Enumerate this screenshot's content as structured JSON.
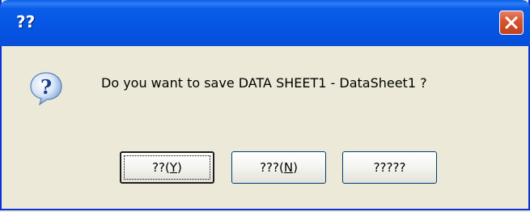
{
  "dialog": {
    "title": "??",
    "message": "Do you want to save DATA SHEET1 - DataSheet1 ?",
    "icon": "question-icon"
  },
  "buttons": {
    "yes": {
      "label_prefix": "??(",
      "mnemonic": "Y",
      "label_suffix": ")"
    },
    "no": {
      "label_prefix": "???(",
      "mnemonic": "N",
      "label_suffix": ")"
    },
    "cancel": {
      "label": "?????"
    }
  },
  "colors": {
    "title_bar": "#0A5EE8",
    "close_button": "#D8552F",
    "dialog_background": "#ECE9D8"
  }
}
